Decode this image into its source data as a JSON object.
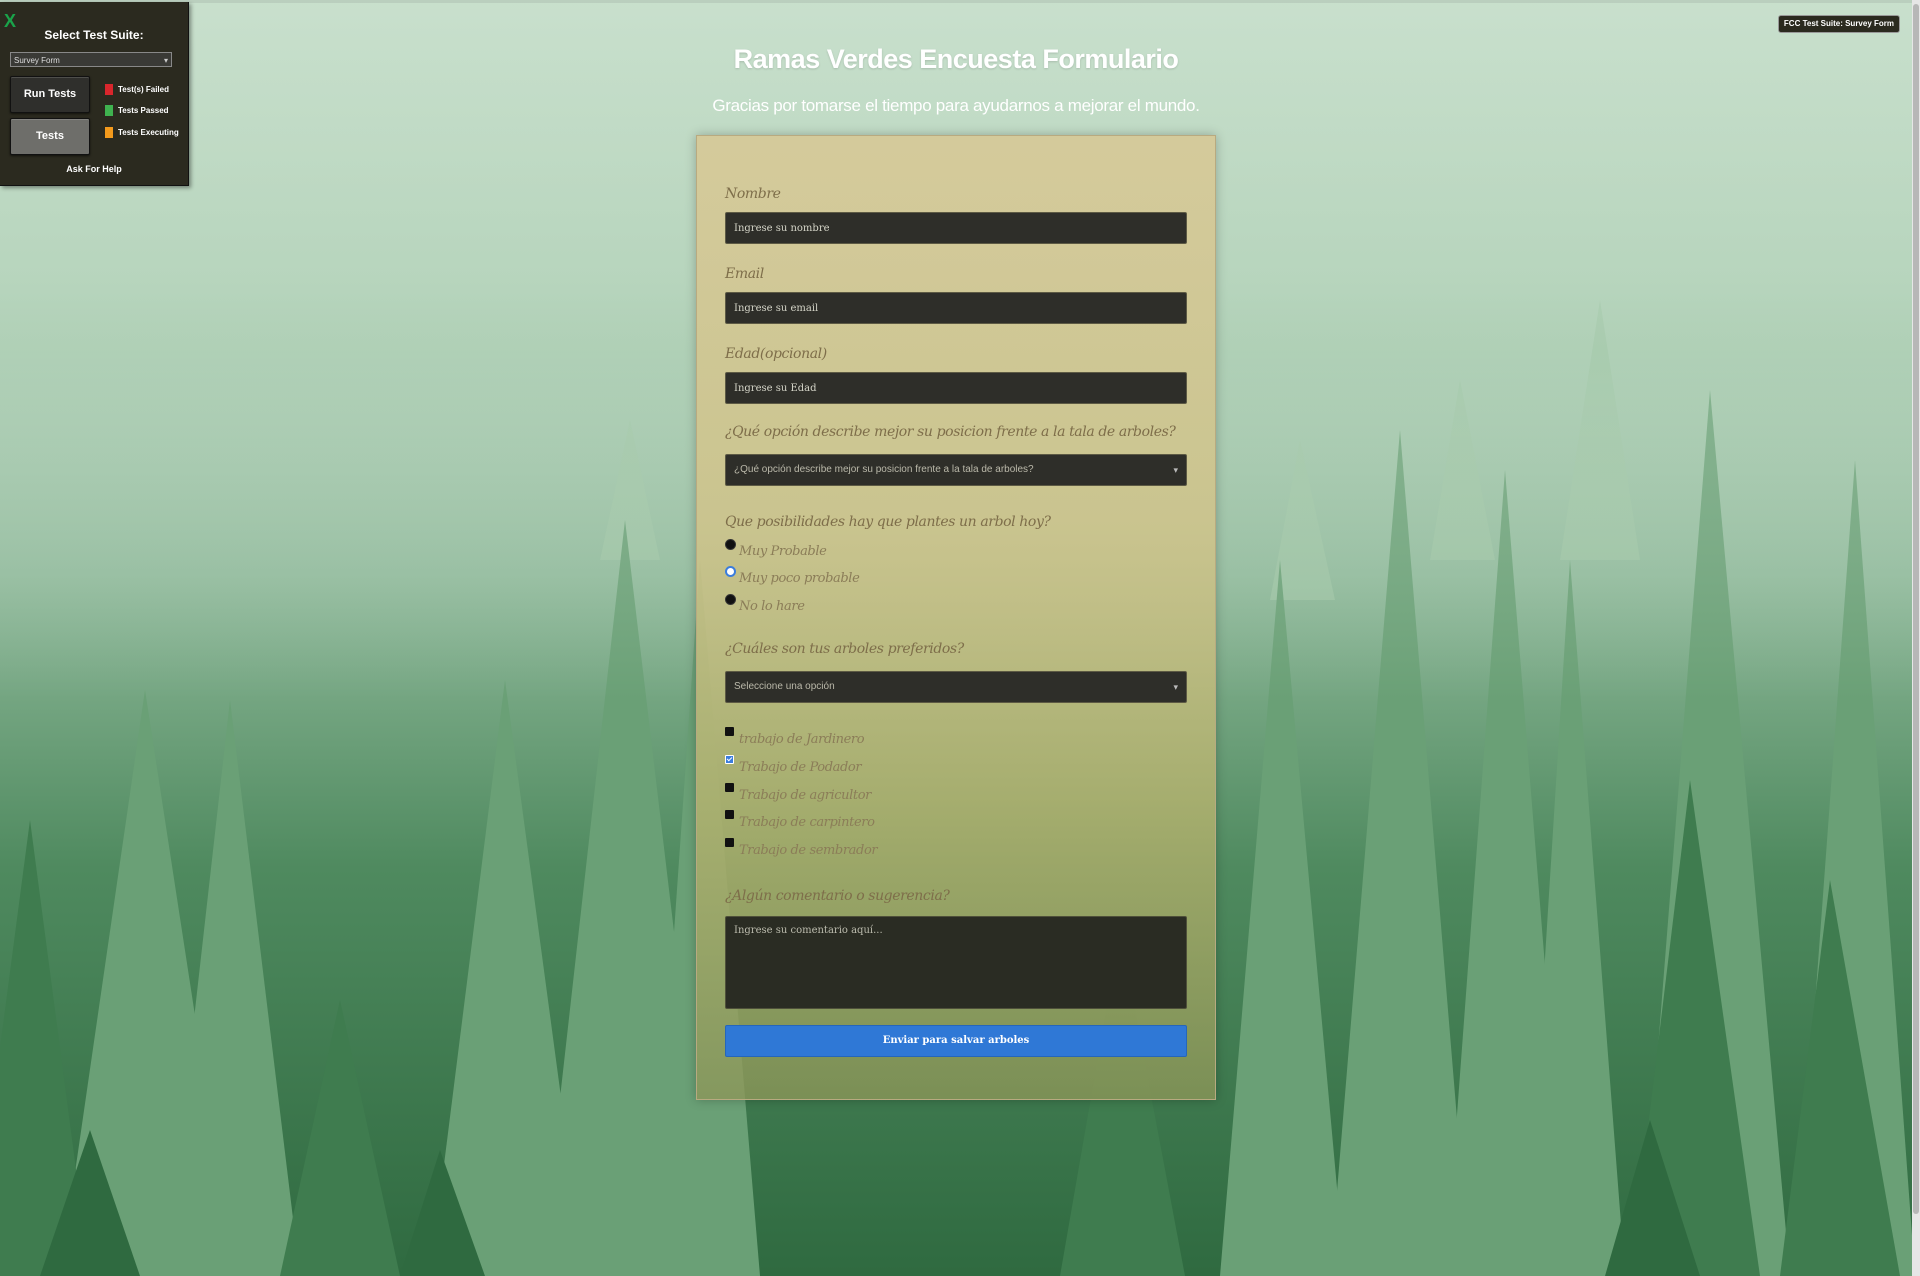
{
  "fcc": {
    "close_glyph": "X",
    "title": "Select Test Suite:",
    "suite_selected": "Survey Form",
    "run_button": "Run Tests",
    "tests_button": "Tests",
    "legend": [
      {
        "label": "Test(s) Failed",
        "color": "#d9262c"
      },
      {
        "label": "Tests Passed",
        "color": "#3fb24f"
      },
      {
        "label": "Tests Executing",
        "color": "#f39a1c"
      }
    ],
    "help": "Ask For Help",
    "badge": "FCC Test Suite: Survey Form"
  },
  "page": {
    "title": "Ramas Verdes Encuesta Formulario",
    "subtitle": "Gracias por tomarse el tiempo para ayudarnos a mejorar el mundo."
  },
  "form": {
    "name": {
      "label": "Nombre",
      "placeholder": "Ingrese su nombre"
    },
    "email": {
      "label": "Email",
      "placeholder": "Ingrese su email"
    },
    "age": {
      "label": "Edad(opcional)",
      "placeholder": "Ingrese su Edad"
    },
    "position": {
      "label": "¿Qué opción describe mejor su posicion frente a la tala de arboles?",
      "selected": "¿Qué opción describe mejor su posicion frente a la tala de arboles?"
    },
    "likelihood": {
      "label": "Que posibilidades hay que plantes un arbol hoy?",
      "options": [
        {
          "label": "Muy Probable",
          "selected": false
        },
        {
          "label": "Muy poco probable",
          "selected": true
        },
        {
          "label": "No lo hare",
          "selected": false
        }
      ]
    },
    "favorite_trees": {
      "label": "¿Cuáles son tus arboles preferidos?",
      "selected": "Seleccione una opción"
    },
    "jobs": [
      {
        "label": "trabajo de Jardinero",
        "checked": false
      },
      {
        "label": "Trabajo de Podador",
        "checked": true
      },
      {
        "label": "Trabajo de agricultor",
        "checked": false
      },
      {
        "label": "Trabajo de carpintero",
        "checked": false
      },
      {
        "label": "Trabajo de sembrador",
        "checked": false
      }
    ],
    "comments": {
      "label": "¿Algún comentario o sugerencia?",
      "placeholder": "Ingrese su comentario aquí..."
    },
    "submit": "Enviar para salvar arboles"
  },
  "colors": {
    "accent": "#2f78d6",
    "input_bg": "#2e2e29",
    "card_bg": "#d6c998",
    "fcc_panel": "#2b2a1f"
  }
}
